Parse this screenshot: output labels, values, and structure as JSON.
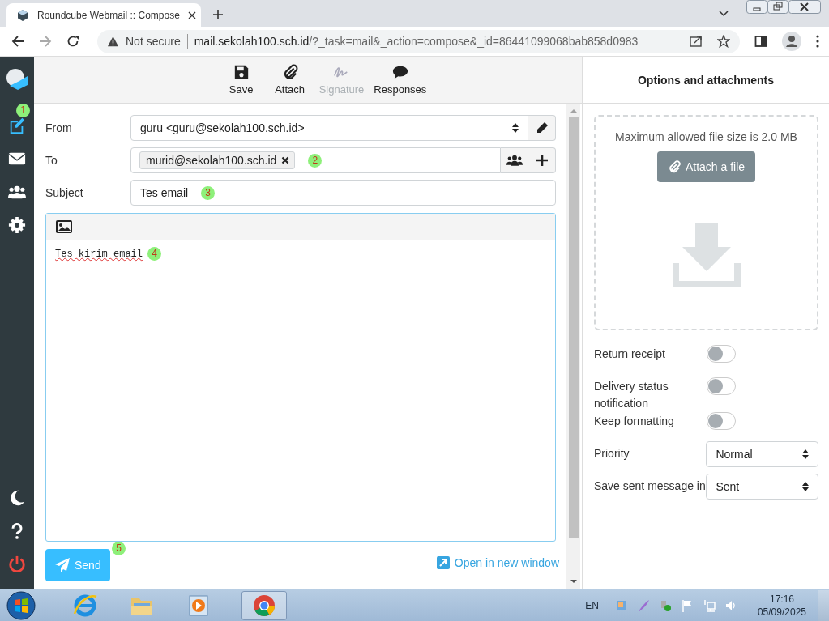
{
  "browser": {
    "tab_title": "Roundcube Webmail :: Compose",
    "security": "Not secure",
    "url_host": "mail.sekolah100.sch.id",
    "url_rest": "/?_task=mail&_action=compose&_id=86441099068bab858d0983"
  },
  "sidebar": {
    "items": [
      {
        "selected": true,
        "marker": "1"
      },
      {
        "selected": false
      },
      {
        "selected": false
      },
      {
        "selected": false
      }
    ]
  },
  "toolbar": [
    {
      "label": "Save",
      "disabled": false
    },
    {
      "label": "Attach",
      "disabled": false
    },
    {
      "label": "Signature",
      "disabled": true
    },
    {
      "label": "Responses",
      "disabled": false
    }
  ],
  "compose": {
    "from": {
      "label": "From",
      "value": "guru <guru@sekolah100.sch.id>"
    },
    "to": {
      "label": "To",
      "recipients": [
        "murid@sekolah100.sch.id"
      ],
      "marker": "2"
    },
    "subject": {
      "label": "Subject",
      "value": "Tes email",
      "marker": "3"
    },
    "body": {
      "text": "Tes kirim email",
      "marker": "4"
    },
    "send": {
      "label": "Send",
      "marker": "5"
    },
    "open_new_window": "Open in new window"
  },
  "options_panel": {
    "title": "Options and attachments",
    "max_size": "Maximum allowed file size is 2.0 MB",
    "attach_button": "Attach a file",
    "options": [
      {
        "kind": "toggle",
        "label": "Return receipt",
        "on": false
      },
      {
        "kind": "toggle",
        "label": "Delivery status notification",
        "on": false
      },
      {
        "kind": "toggle",
        "label": "Keep formatting",
        "on": false
      },
      {
        "kind": "select",
        "label": "Priority",
        "value": "Normal"
      },
      {
        "kind": "select",
        "label": "Save sent message in",
        "value": "Sent"
      }
    ]
  },
  "taskbar": {
    "language": "EN",
    "time": "17:16",
    "date": "05/09/2025"
  }
}
